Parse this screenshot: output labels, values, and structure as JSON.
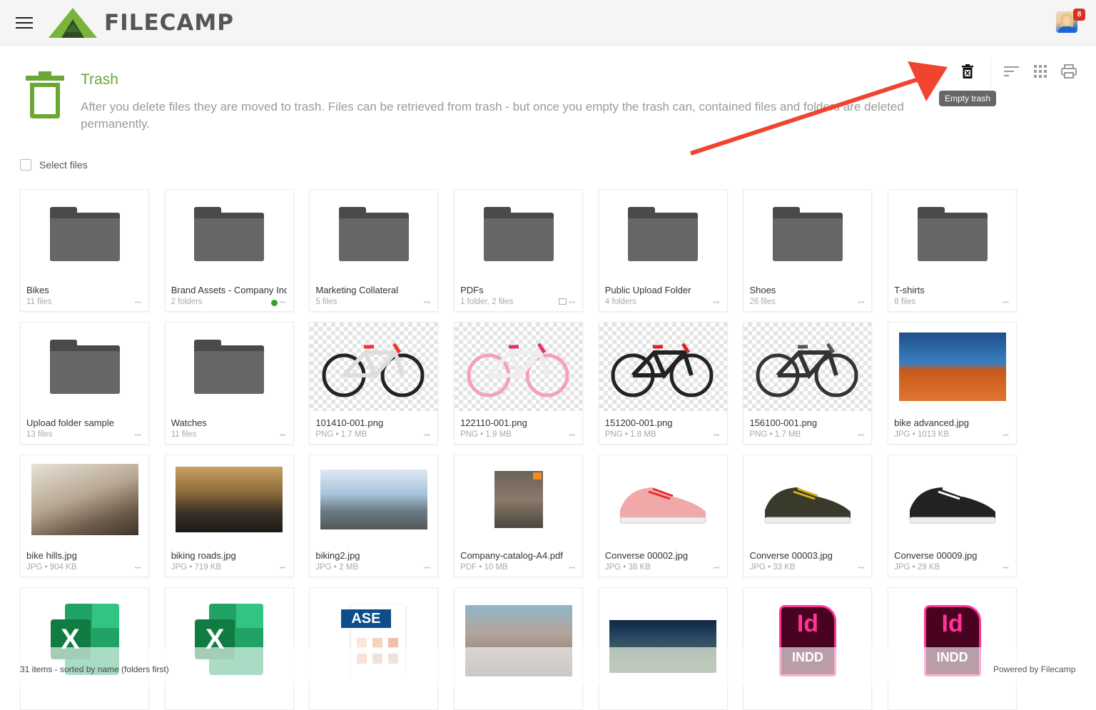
{
  "app": {
    "name": "FILECAMP",
    "notification_count": "8"
  },
  "page": {
    "title": "Trash",
    "description": "After you delete files they are moved to trash. Files can be retrieved from trash - but once you empty the trash can, contained files and folders are deleted permanently."
  },
  "toolbar": {
    "empty_trash_tooltip": "Empty trash",
    "buttons": [
      "empty-trash",
      "sort",
      "grid-view",
      "print"
    ]
  },
  "select_files_label": "Select files",
  "items": [
    {
      "name": "Bikes",
      "meta": "11 files",
      "type": "folder"
    },
    {
      "name": "Brand Assets - Company Inc",
      "meta": "2 folders",
      "type": "folder",
      "status": "online"
    },
    {
      "name": "Marketing Collateral",
      "meta": "5 files",
      "type": "folder"
    },
    {
      "name": "PDFs",
      "meta": "1 folder, 2 files",
      "type": "folder",
      "has_comment": true
    },
    {
      "name": "Public Upload Folder",
      "meta": "4 folders",
      "type": "folder"
    },
    {
      "name": "Shoes",
      "meta": "26 files",
      "type": "folder"
    },
    {
      "name": "T-shirts",
      "meta": "8 files",
      "type": "folder"
    },
    {
      "name": "Upload folder sample",
      "meta": "13 files",
      "type": "folder"
    },
    {
      "name": "Watches",
      "meta": "11 files",
      "type": "folder"
    },
    {
      "name": "101410-001.png",
      "meta": "PNG • 1.7 MB",
      "type": "bike-white"
    },
    {
      "name": "122110-001.png",
      "meta": "PNG • 1.9 MB",
      "type": "bike-pink"
    },
    {
      "name": "151200-001.png",
      "meta": "PNG • 1.8 MB",
      "type": "bike-red"
    },
    {
      "name": "156100-001.png",
      "meta": "PNG • 1.7 MB",
      "type": "bike-dark"
    },
    {
      "name": "bike advanced.jpg",
      "meta": "JPG • 1013 KB",
      "type": "photo-desert"
    },
    {
      "name": "bike hills.jpg",
      "meta": "JPG • 904 KB",
      "type": "photo-hills"
    },
    {
      "name": "biking roads.jpg",
      "meta": "JPG • 719 KB",
      "type": "photo-road"
    },
    {
      "name": "biking2.jpg",
      "meta": "JPG • 2 MB",
      "type": "photo-coast"
    },
    {
      "name": "Company-catalog-A4.pdf",
      "meta": "PDF • 10 MB",
      "type": "pdf"
    },
    {
      "name": "Converse 00002.jpg",
      "meta": "JPG • 38 KB",
      "type": "shoe-pink"
    },
    {
      "name": "Converse 00003.jpg",
      "meta": "JPG • 33 KB",
      "type": "shoe-olive"
    },
    {
      "name": "Converse 00009.jpg",
      "meta": "JPG • 29 KB",
      "type": "shoe-black"
    },
    {
      "name": "",
      "meta": "",
      "type": "xlsx"
    },
    {
      "name": "",
      "meta": "",
      "type": "xlsx"
    },
    {
      "name": "",
      "meta": "",
      "type": "ase"
    },
    {
      "name": "",
      "meta": "",
      "type": "photo-gym"
    },
    {
      "name": "",
      "meta": "",
      "type": "photo-stadium"
    },
    {
      "name": "",
      "meta": "",
      "type": "indd"
    },
    {
      "name": "",
      "meta": "",
      "type": "indd"
    }
  ],
  "icon_labels": {
    "ase": "ASE",
    "indd": "INDD",
    "indd_glyph": "Id",
    "xlsx_glyph": "X"
  },
  "footer": {
    "summary": "31 items - sorted by name (folders first)",
    "powered_by": "Powered by Filecamp"
  },
  "colors": {
    "brand_green": "#6aa734",
    "badge_red": "#d93025",
    "arrow_red": "#ef4530"
  }
}
